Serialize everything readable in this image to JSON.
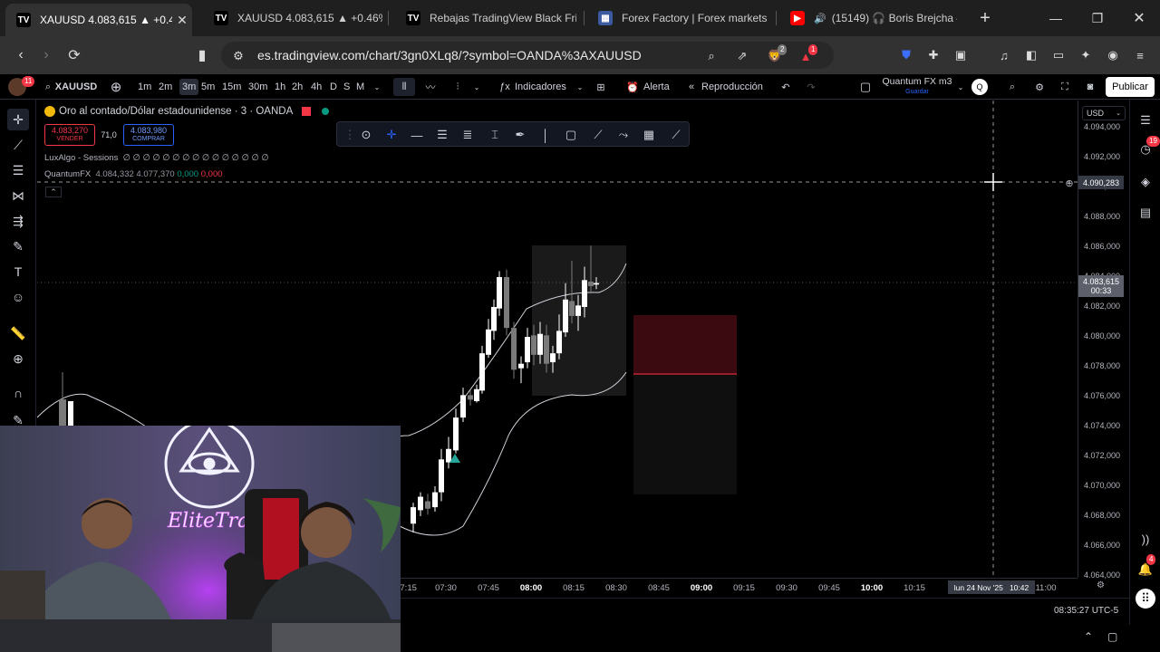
{
  "browser": {
    "tabs": [
      {
        "title": "XAUUSD 4.083,615 ▲ +0.4",
        "active": true
      },
      {
        "title": "XAUUSD 4.083,615 ▲ +0.46% (",
        "active": false
      },
      {
        "title": "Rebajas TradingView Black Frid",
        "active": false
      },
      {
        "title": "Forex Factory | Forex markets fo",
        "active": false
      },
      {
        "title": "(15149) 🎧 Boris Brejcha –",
        "active": false
      }
    ],
    "url": "es.tradingview.com/chart/3gn0XLq8/?symbol=OANDA%3AXAUUSD",
    "brave_badge": "2",
    "alert_badge": "1"
  },
  "toolbar": {
    "avatar_badge": "11",
    "symbol": "XAUUSD",
    "timeframes": [
      "1m",
      "2m",
      "3m",
      "5m",
      "15m",
      "30m",
      "1h",
      "2h",
      "4h",
      "D",
      "S",
      "M"
    ],
    "selected_timeframe": "3m",
    "indicators_label": "Indicadores",
    "alert_label": "Alerta",
    "replay_label": "Reproducción",
    "layout_name": "Quantum FX m3",
    "layout_status": "Guardar",
    "layout_avatar": "Q",
    "publish_label": "Publicar"
  },
  "legend": {
    "title": "Oro al contado/Dólar estadounidense · 3 · OANDA",
    "sell_price": "4.083,270",
    "sell_label": "VENDER",
    "spread": "71,0",
    "buy_price": "4.083,980",
    "buy_label": "COMPRAR",
    "indicator1_name": "LuxAlgo - Sessions",
    "indicator1_values": "∅ ∅ ∅ ∅ ∅ ∅ ∅ ∅ ∅ ∅ ∅ ∅ ∅ ∅ ∅",
    "indicator2_name": "QuantumFX",
    "indicator2_v1": "4.084,332",
    "indicator2_v2": "4.077,370",
    "indicator2_v3": "0,000",
    "indicator2_v4": "0,000"
  },
  "price_scale": {
    "currency": "USD",
    "labels": [
      "4.094,000",
      "4.092,000",
      "4.090,000",
      "4.088,000",
      "4.086,000",
      "4.084,000",
      "4.082,000",
      "4.080,000",
      "4.078,000",
      "4.076,000",
      "4.074,000",
      "4.072,000",
      "4.070,000",
      "4.068,000",
      "4.066,000",
      "4.064,000"
    ],
    "crosshair_price": "4.090,283",
    "last_price": "4.083,615",
    "countdown": "00:33"
  },
  "time_scale": {
    "labels": [
      {
        "text": "07:15",
        "bold": false
      },
      {
        "text": "07:30",
        "bold": false
      },
      {
        "text": "07:45",
        "bold": false
      },
      {
        "text": "08:00",
        "bold": true
      },
      {
        "text": "08:15",
        "bold": false
      },
      {
        "text": "08:30",
        "bold": false
      },
      {
        "text": "08:45",
        "bold": false
      },
      {
        "text": "09:00",
        "bold": true
      },
      {
        "text": "09:15",
        "bold": false
      },
      {
        "text": "09:30",
        "bold": false
      },
      {
        "text": "09:45",
        "bold": false
      },
      {
        "text": "10:00",
        "bold": true
      },
      {
        "text": "10:15",
        "bold": false
      },
      {
        "text": "11:00",
        "bold": false
      }
    ],
    "crosshair_time": "lun 24 Nov '25   10:42",
    "clock": "08:35:27 UTC-5"
  },
  "right_panel": {
    "notifications_badge": "19",
    "alerts_badge": "4"
  },
  "webcam": {
    "sign": "EliteTrader"
  },
  "colors": {
    "up": "#ffffff",
    "down": "#7a7a7a",
    "sell": "#f23645",
    "buy": "#2962ff",
    "zone_red": "#3a0a10"
  }
}
